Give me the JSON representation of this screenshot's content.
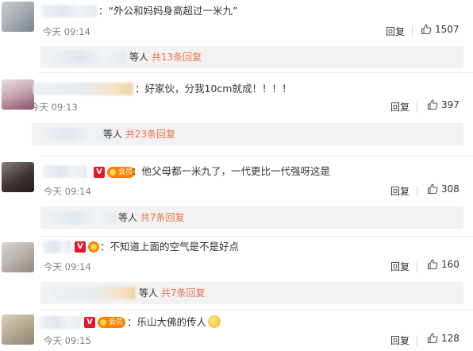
{
  "actions": {
    "reply_label": "回复",
    "ellipsis": "："
  },
  "badges": {
    "verified": "V",
    "member": "会员"
  },
  "comments": [
    {
      "text": "“外公和妈妈身高超过一米九”",
      "time": "今天 09:14",
      "likes": "1507",
      "thread": {
        "suffix": "等人",
        "link": "共13条回复"
      }
    },
    {
      "text": "好家伙，分我10cm就成！！！！",
      "time": "今天 09:13",
      "likes": "397",
      "thread": {
        "suffix": "等人",
        "link": "共23条回复"
      }
    },
    {
      "text": "他父母都一米九了，一代更比一代强呀这是",
      "time": "今天 09:14",
      "likes": "308",
      "thread": {
        "suffix": "等人",
        "link": "共7条回复"
      }
    },
    {
      "text": "不知道上面的空气是不是好点",
      "time": "今天 09:14",
      "likes": "160",
      "thread": {
        "suffix": "等人",
        "link": "共7条回复"
      }
    },
    {
      "text": "乐山大佛的传人",
      "time": "今天 09:15",
      "likes": "128"
    }
  ],
  "icons": {
    "like": "thumbs-up-icon",
    "laugh": "laughing-emoji-icon"
  },
  "colors": {
    "link": "#eb7350",
    "verified": "#e6162d",
    "member": "#ff8200",
    "thread_bg": "#f2f2f2"
  }
}
